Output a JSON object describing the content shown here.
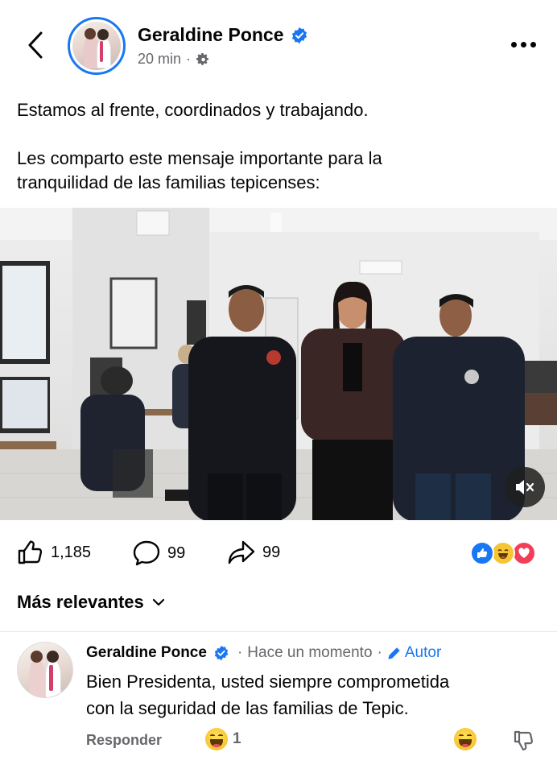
{
  "header": {
    "name": "Geraldine Ponce",
    "time": "20 min",
    "separator": "·",
    "privacy_icon": "gear-icon",
    "back_icon": "chevron-left-icon",
    "more_icon": "more-dots-icon"
  },
  "post": {
    "line1": "Estamos al frente, coordinados y trabajando.",
    "line2": "Les comparto este mensaje importante para la",
    "line3": "tranquilidad de las familias tepicenses:"
  },
  "video": {
    "mute_icon": "speaker-muted-icon"
  },
  "stats": {
    "likes": "1,185",
    "comments": "99",
    "shares": "99",
    "reaction_icons": [
      "like-icon",
      "haha-icon",
      "love-icon"
    ],
    "colors": {
      "like": "#1877f2",
      "love": "#f33e58",
      "haha": "#f7c533"
    }
  },
  "sort": {
    "label": "Más relevantes"
  },
  "comment": {
    "author": "Geraldine Ponce",
    "time": "Hace un momento",
    "separator": "·",
    "badge": "Autor",
    "line1": "Bien Presidenta, usted siempre comprometida",
    "line2": "con la seguridad de las familias de Tepic.",
    "reply_label": "Responder",
    "reaction_count": "1"
  },
  "colors": {
    "accent": "#1877f2",
    "secondary_text": "#65676b"
  }
}
